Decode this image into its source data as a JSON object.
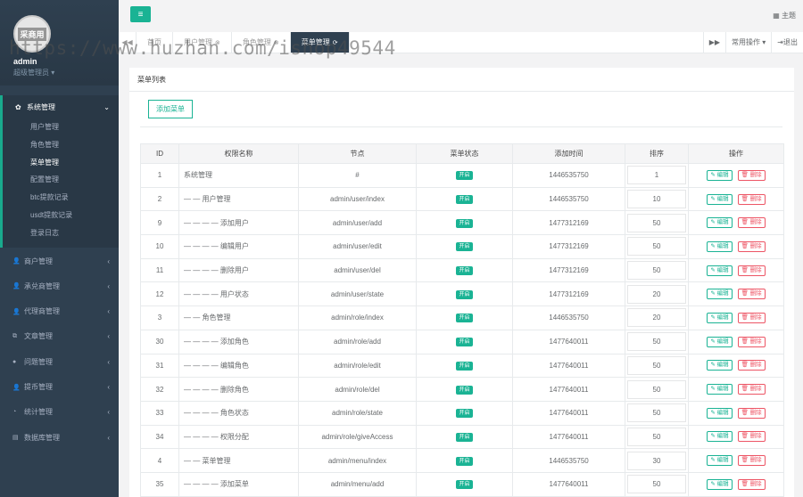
{
  "profile": {
    "avatar_text": "采商用",
    "name": "admin",
    "role": "超级管理员"
  },
  "topbar": {
    "menu_icon": "hamburger-icon",
    "theme_label": "主题"
  },
  "tabs": {
    "items": [
      {
        "label": "首页",
        "closable": false,
        "active": false
      },
      {
        "label": "用户管理",
        "closable": true,
        "active": false
      },
      {
        "label": "角色管理",
        "closable": true,
        "active": false
      },
      {
        "label": "菜单管理",
        "closable": true,
        "active": true
      }
    ],
    "common_ops_label": "常用操作",
    "logout_label": "退出"
  },
  "sidebar": {
    "section": {
      "label": "系统管理",
      "items": [
        "用户管理",
        "角色管理",
        "菜单管理",
        "配置管理",
        "btc提款记录",
        "usdt提款记录",
        "登录日志"
      ],
      "active_index": 2
    },
    "items": [
      {
        "label": "商户管理",
        "icon": "user-icon"
      },
      {
        "label": "承兑商管理",
        "icon": "user-icon"
      },
      {
        "label": "代理商管理",
        "icon": "user-icon"
      },
      {
        "label": "文章管理",
        "icon": "copy-icon"
      },
      {
        "label": "问题管理",
        "icon": "comment-icon"
      },
      {
        "label": "提币管理",
        "icon": "user-icon"
      },
      {
        "label": "统计管理",
        "icon": "dashboard-icon"
      },
      {
        "label": "数据库管理",
        "icon": "database-icon"
      }
    ]
  },
  "panel": {
    "title": "菜单列表",
    "add_button": "添加菜单",
    "columns": [
      "ID",
      "权限名称",
      "节点",
      "菜单状态",
      "添加时间",
      "排序",
      "操作"
    ],
    "edit_label": "编辑",
    "delete_label": "删除",
    "rows": [
      {
        "id": "1",
        "name": "系统管理",
        "node": "#",
        "status": "开启",
        "time": "1446535750",
        "sort": "1"
      },
      {
        "id": "2",
        "name": "— — 用户管理",
        "node": "admin/user/index",
        "status": "开启",
        "time": "1446535750",
        "sort": "10"
      },
      {
        "id": "9",
        "name": "— — — — 添加用户",
        "node": "admin/user/add",
        "status": "开启",
        "time": "1477312169",
        "sort": "50"
      },
      {
        "id": "10",
        "name": "— — — — 编辑用户",
        "node": "admin/user/edit",
        "status": "开启",
        "time": "1477312169",
        "sort": "50"
      },
      {
        "id": "11",
        "name": "— — — — 删除用户",
        "node": "admin/user/del",
        "status": "开启",
        "time": "1477312169",
        "sort": "50"
      },
      {
        "id": "12",
        "name": "— — — — 用户状态",
        "node": "admin/user/state",
        "status": "开启",
        "time": "1477312169",
        "sort": "20"
      },
      {
        "id": "3",
        "name": "— — 角色管理",
        "node": "admin/role/index",
        "status": "开启",
        "time": "1446535750",
        "sort": "20"
      },
      {
        "id": "30",
        "name": "— — — — 添加角色",
        "node": "admin/role/add",
        "status": "开启",
        "time": "1477640011",
        "sort": "50"
      },
      {
        "id": "31",
        "name": "— — — — 编辑角色",
        "node": "admin/role/edit",
        "status": "开启",
        "time": "1477640011",
        "sort": "50"
      },
      {
        "id": "32",
        "name": "— — — — 删除角色",
        "node": "admin/role/del",
        "status": "开启",
        "time": "1477640011",
        "sort": "50"
      },
      {
        "id": "33",
        "name": "— — — — 角色状态",
        "node": "admin/role/state",
        "status": "开启",
        "time": "1477640011",
        "sort": "50"
      },
      {
        "id": "34",
        "name": "— — — — 权限分配",
        "node": "admin/role/giveAccess",
        "status": "开启",
        "time": "1477640011",
        "sort": "50"
      },
      {
        "id": "4",
        "name": "— — 菜单管理",
        "node": "admin/menu/index",
        "status": "开启",
        "time": "1446535750",
        "sort": "30"
      },
      {
        "id": "35",
        "name": "— — — — 添加菜单",
        "node": "admin/menu/add",
        "status": "开启",
        "time": "1477640011",
        "sort": "50"
      }
    ]
  },
  "watermark": "https://www.huzhan.com/ishop49544",
  "colors": {
    "sidebar_bg": "#2f4050",
    "accent": "#1ab394",
    "danger": "#ed5565"
  }
}
